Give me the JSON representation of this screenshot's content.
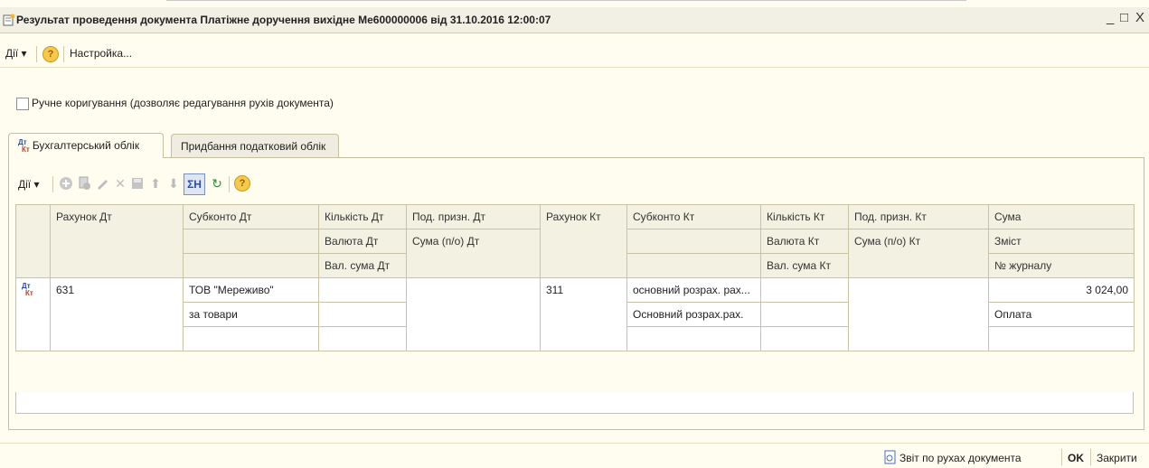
{
  "window": {
    "title": "Результат проведення документа Платіжне доручення вихідне Ме600000006 від 31.10.2016 12:00:07",
    "minimize": "_",
    "maximize": "□",
    "close": "X"
  },
  "menubar": {
    "actions": "Дії ▾",
    "help": "?",
    "settings": "Настройка..."
  },
  "manual_edit": {
    "label": "Ручне коригування (дозволяє редагування рухів документа)",
    "checked": false
  },
  "tabs": [
    {
      "label": "Бухгалтерський облік",
      "active": true,
      "icon": "dt-kt-icon"
    },
    {
      "label": "Придбання податковий облік",
      "active": false
    }
  ],
  "toolbar": {
    "actions": "Дії ▾",
    "icons": [
      "add-icon",
      "copy-icon",
      "edit-icon",
      "delete-icon",
      "save-icon",
      "move-up-icon",
      "move-down-icon",
      "totals-icon",
      "refresh-icon",
      "help-icon"
    ],
    "totals_label": "ΣН",
    "help": "?"
  },
  "grid": {
    "header_row1": [
      "",
      "Рахунок Дт",
      "Субконто Дт",
      "Кількість Дт",
      "Под. призн. Дт",
      "Рахунок Кт",
      "Субконто Кт",
      "Кількість Кт",
      "Под. призн. Кт",
      "Сума"
    ],
    "header_row2": [
      "Валюта Дт",
      "Сума (п/о) Дт",
      "Валюта Кт",
      "Сума (п/о) Кт",
      "Зміст"
    ],
    "header_row3": [
      "Вал. сума Дт",
      "Вал. сума Кт",
      "№ журналу"
    ],
    "rows": [
      {
        "icon_dt": "Дт",
        "icon_kt": "Кт",
        "account_dt": "631",
        "subconto_dt_1": "ТОВ \"Мереживо\"",
        "subconto_dt_2": "за товари",
        "account_kt": "311",
        "subconto_kt_1": "основний розрах. рах...",
        "subconto_kt_2": "Основний розрах.рах.",
        "sum": "3 024,00",
        "content": "Оплата"
      }
    ]
  },
  "footer": {
    "report": "Звіт по рухах документа",
    "ok": "OK",
    "close": "Закрити"
  },
  "colors": {
    "background": "#fffdf0",
    "header_bg": "#f3f1e2",
    "border": "#c9c3a6"
  }
}
